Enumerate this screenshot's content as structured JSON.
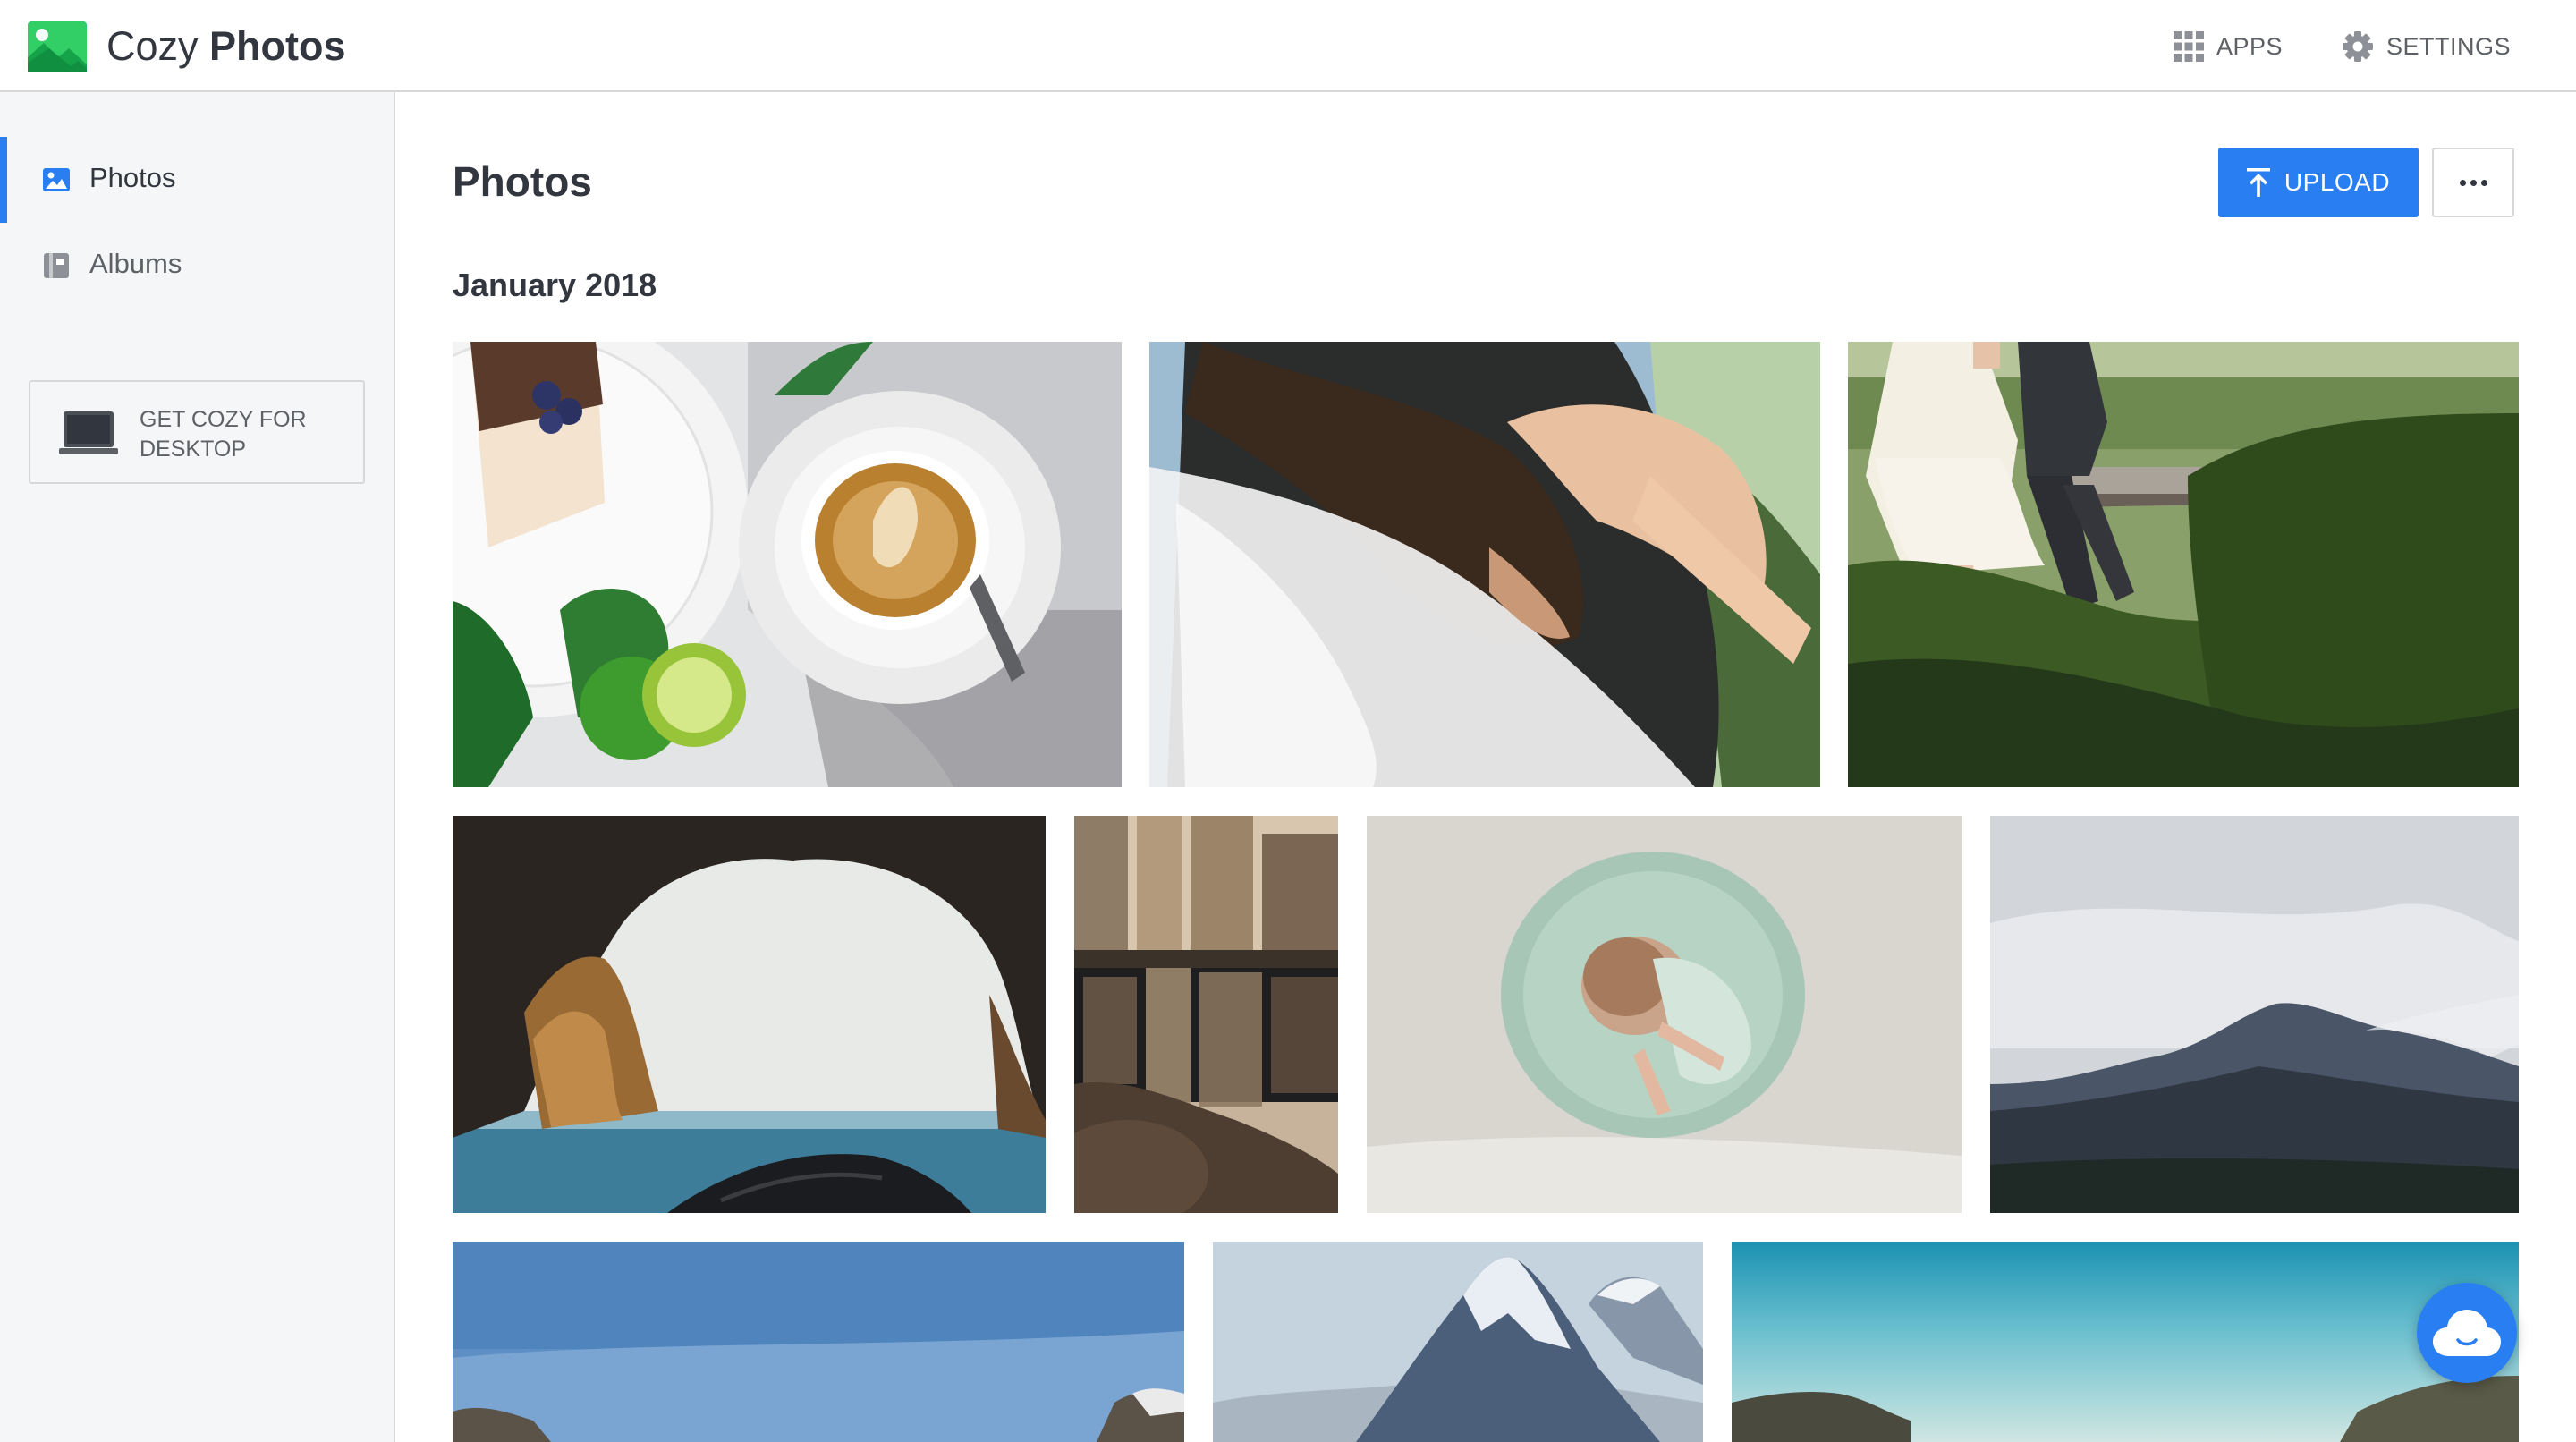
{
  "app": {
    "name_light": "Cozy",
    "name_bold": "Photos",
    "logo_icon": "photos-app-logo",
    "accent_color": "#297ef2"
  },
  "topnav": {
    "apps_label": "APPS",
    "apps_icon": "grid-icon",
    "settings_label": "SETTINGS",
    "settings_icon": "gear-icon"
  },
  "sidebar": {
    "items": [
      {
        "label": "Photos",
        "icon": "photo-icon",
        "active": true
      },
      {
        "label": "Albums",
        "icon": "album-icon",
        "active": false
      }
    ],
    "desktop_promo": {
      "label": "GET COZY FOR DESKTOP",
      "icon": "laptop-icon"
    }
  },
  "main": {
    "title": "Photos",
    "upload_label": "UPLOAD",
    "upload_icon": "upload-icon",
    "more_icon": "more-icon",
    "section": "January 2018",
    "photos": [
      {
        "subject": "cake-and-coffee"
      },
      {
        "subject": "bride-veil"
      },
      {
        "subject": "couple-on-bench"
      },
      {
        "subject": "sea-cave"
      },
      {
        "subject": "city-reflection"
      },
      {
        "subject": "baby"
      },
      {
        "subject": "misty-mountain"
      },
      {
        "subject": "blue-sky-mountains"
      },
      {
        "subject": "snowy-peak"
      },
      {
        "subject": "turquoise-valley"
      }
    ]
  },
  "fab": {
    "icon": "cozy-cloud-icon"
  }
}
